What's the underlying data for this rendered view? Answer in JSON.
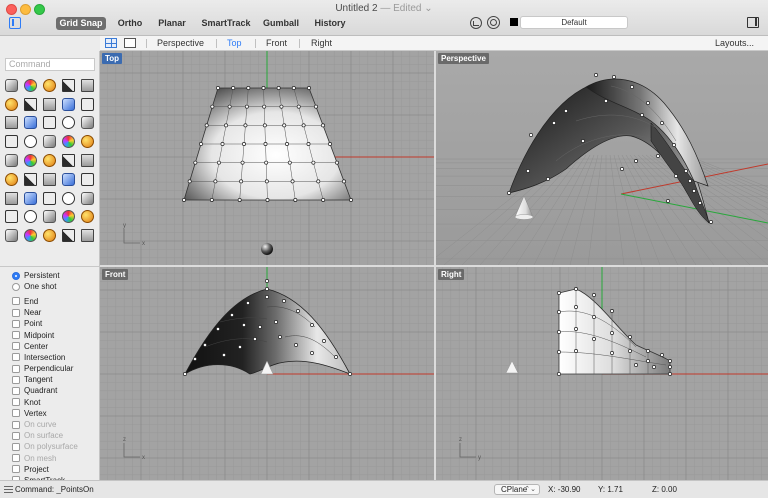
{
  "window": {
    "title": "Untitled 2",
    "edited": "— Edited ⌄"
  },
  "toolbar": {
    "buttons": [
      "Grid Snap",
      "Ortho",
      "Planar",
      "SmartTrack",
      "Gumball",
      "History"
    ],
    "active_button": "Grid Snap",
    "layer": "Default"
  },
  "viewport_tabs": {
    "tabs": [
      "Perspective",
      "Top",
      "Front",
      "Right"
    ],
    "active": "Top",
    "layouts_label": "Layouts..."
  },
  "command": {
    "placeholder": "Command"
  },
  "tools": {
    "icons": [
      "select-arrow-icon",
      "point-icon",
      "polyline-icon",
      "curve-icon",
      "circle-icon",
      "eye-view-icon",
      "rectangle-icon",
      "polygon-icon",
      "offset-icon",
      "fillet-icon",
      "surface-icon",
      "loft-icon",
      "sweep-icon",
      "box-icon",
      "cylinder-icon",
      "edit-points-icon",
      "extrude-icon",
      "boolean-icon",
      "shell-icon",
      "trim-icon",
      "paint-icon",
      "join-icon",
      "split-icon",
      "extend-icon",
      "dimension-icon",
      "transform-icon",
      "gumball-icon",
      "array-icon",
      "rotate-icon",
      "scale-icon",
      "grid-icon",
      "mirror-icon",
      "analyze-icon",
      "check-icon",
      "zoom-icon",
      "smooth-icon",
      "render-icon",
      "material-icon",
      "environment-icon",
      "light-icon",
      "lock-icon",
      "layer-icon",
      "color-wheel-icon",
      "globe-icon",
      "settings-icon"
    ]
  },
  "snaps": {
    "modes": [
      {
        "label": "Persistent",
        "selected": true
      },
      {
        "label": "One shot",
        "selected": false
      }
    ],
    "osnaps": [
      {
        "label": "End",
        "dim": false
      },
      {
        "label": "Near",
        "dim": false
      },
      {
        "label": "Point",
        "dim": false
      },
      {
        "label": "Midpoint",
        "dim": false
      },
      {
        "label": "Center",
        "dim": false
      },
      {
        "label": "Intersection",
        "dim": false
      },
      {
        "label": "Perpendicular",
        "dim": false
      },
      {
        "label": "Tangent",
        "dim": false
      },
      {
        "label": "Quadrant",
        "dim": false
      },
      {
        "label": "Knot",
        "dim": false
      },
      {
        "label": "Vertex",
        "dim": false
      },
      {
        "label": "On curve",
        "dim": true
      },
      {
        "label": "On surface",
        "dim": true
      },
      {
        "label": "On polysurface",
        "dim": true
      },
      {
        "label": "On mesh",
        "dim": true
      },
      {
        "label": "Project",
        "dim": false
      },
      {
        "label": "SmartTrack",
        "dim": false
      }
    ]
  },
  "viewports": {
    "top": {
      "label": "Top"
    },
    "perspective": {
      "label": "Perspective"
    },
    "front": {
      "label": "Front"
    },
    "right": {
      "label": "Right"
    },
    "axis_x": "x",
    "axis_y": "y",
    "axis_z": "z"
  },
  "colors": {
    "accent": "#2e7cf6",
    "x_axis": "#c0392b",
    "y_axis": "#27a83a",
    "viewport_bg": "#a3a3a3"
  },
  "status": {
    "command": "Command: _PointsOn",
    "cplane": "CPlane",
    "x": "X: -30.90",
    "y": "Y: 1.71",
    "z": "Z: 0.00"
  }
}
